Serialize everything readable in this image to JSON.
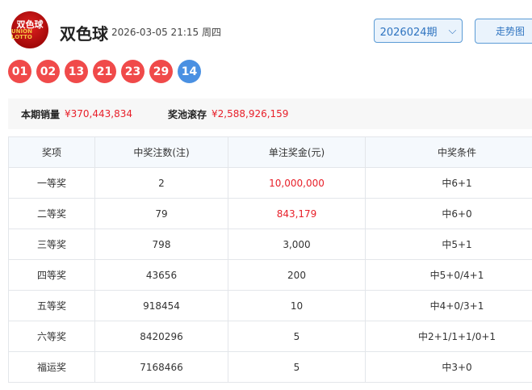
{
  "header": {
    "logo_text": "双色球 UNION LOTTO",
    "title": "双色球",
    "datetime": "2026-03-05 21:15 周四",
    "period": "2026024期",
    "trend_button": "走势图"
  },
  "balls": {
    "red": [
      "01",
      "02",
      "13",
      "21",
      "23",
      "29"
    ],
    "blue": "14"
  },
  "colors": {
    "red_ball": "#f04a4a",
    "blue_ball": "#4a90e2",
    "accent": "#e8202a"
  },
  "summary": {
    "sales_label": "本期销量",
    "sales_value": "¥370,443,834",
    "pool_label": "奖池滚存",
    "pool_value": "¥2,588,926,159"
  },
  "table": {
    "headers": [
      "奖项",
      "中奖注数(注)",
      "单注奖金(元)",
      "中奖条件"
    ],
    "rows": [
      [
        "一等奖",
        "2",
        "10,000,000",
        "中6+1"
      ],
      [
        "二等奖",
        "79",
        "843,179",
        "中6+0"
      ],
      [
        "三等奖",
        "798",
        "3,000",
        "中5+1"
      ],
      [
        "四等奖",
        "43656",
        "200",
        "中5+0/4+1"
      ],
      [
        "五等奖",
        "918454",
        "10",
        "中4+0/3+1"
      ],
      [
        "六等奖",
        "8420296",
        "5",
        "中2+1/1+1/0+1"
      ],
      [
        "福运奖",
        "7168466",
        "5",
        "中3+0"
      ]
    ]
  }
}
